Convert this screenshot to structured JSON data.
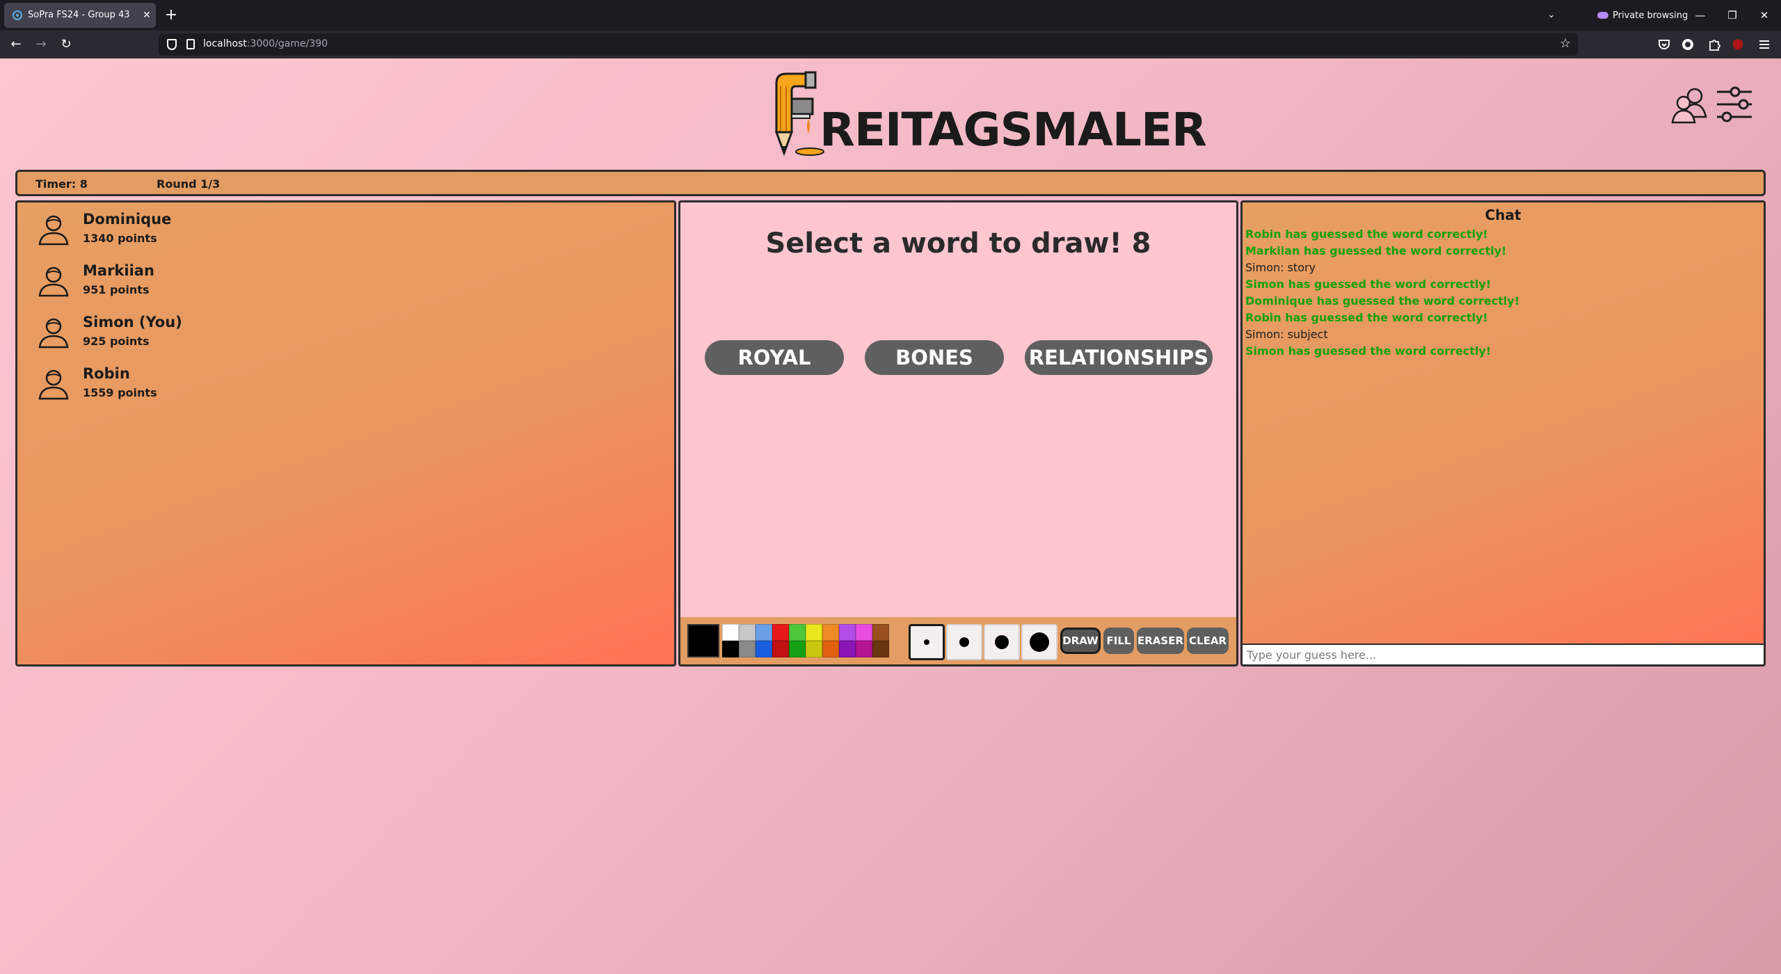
{
  "browser": {
    "tab_title": "SoPra FS24 - Group 43",
    "new_tab_label": "+",
    "private_label": "Private browsing",
    "url_host": "localhost",
    "url_path": ":3000/game/390"
  },
  "app": {
    "logo_text": "REITAGSMALER",
    "timer_label": "Timer: 8",
    "round_label": "Round 1/3"
  },
  "players": [
    {
      "name": "Dominique",
      "points": "1340 points"
    },
    {
      "name": "Markiian",
      "points": "951 points"
    },
    {
      "name": "Simon (You)",
      "points": "925 points"
    },
    {
      "name": "Robin",
      "points": "1559 points"
    }
  ],
  "board": {
    "title": "Select a word to draw! 8",
    "words": [
      "ROYAL",
      "BONES",
      "RELATIONSHIPS"
    ],
    "current_color": "#000000",
    "palette": [
      "#ffffff",
      "#c8c8c8",
      "#6b9fe8",
      "#e81818",
      "#4cc83a",
      "#e8e81e",
      "#f08a24",
      "#b44ce8",
      "#e84ce0",
      "#9a5020",
      "#000000",
      "#8a8a8a",
      "#1a5ee0",
      "#c01010",
      "#14a014",
      "#c8c810",
      "#e06010",
      "#8a14b4",
      "#b41490",
      "#6b3410"
    ],
    "tools": [
      "DRAW",
      "FILL",
      "ERASER",
      "CLEAR"
    ],
    "active_tool": "DRAW"
  },
  "chat": {
    "title": "Chat",
    "messages": [
      {
        "text": "Robin has guessed the word correctly!",
        "type": "correct"
      },
      {
        "text": "Markiian has guessed the word correctly!",
        "type": "correct"
      },
      {
        "text": "Simon: story",
        "type": "normal"
      },
      {
        "text": "Simon has guessed the word correctly!",
        "type": "correct"
      },
      {
        "text": "Dominique has guessed the word correctly!",
        "type": "correct"
      },
      {
        "text": "Robin has guessed the word correctly!",
        "type": "correct"
      },
      {
        "text": "Simon: subject",
        "type": "normal"
      },
      {
        "text": "Simon has guessed the word correctly!",
        "type": "correct"
      }
    ],
    "input_placeholder": "Type your guess here..."
  }
}
